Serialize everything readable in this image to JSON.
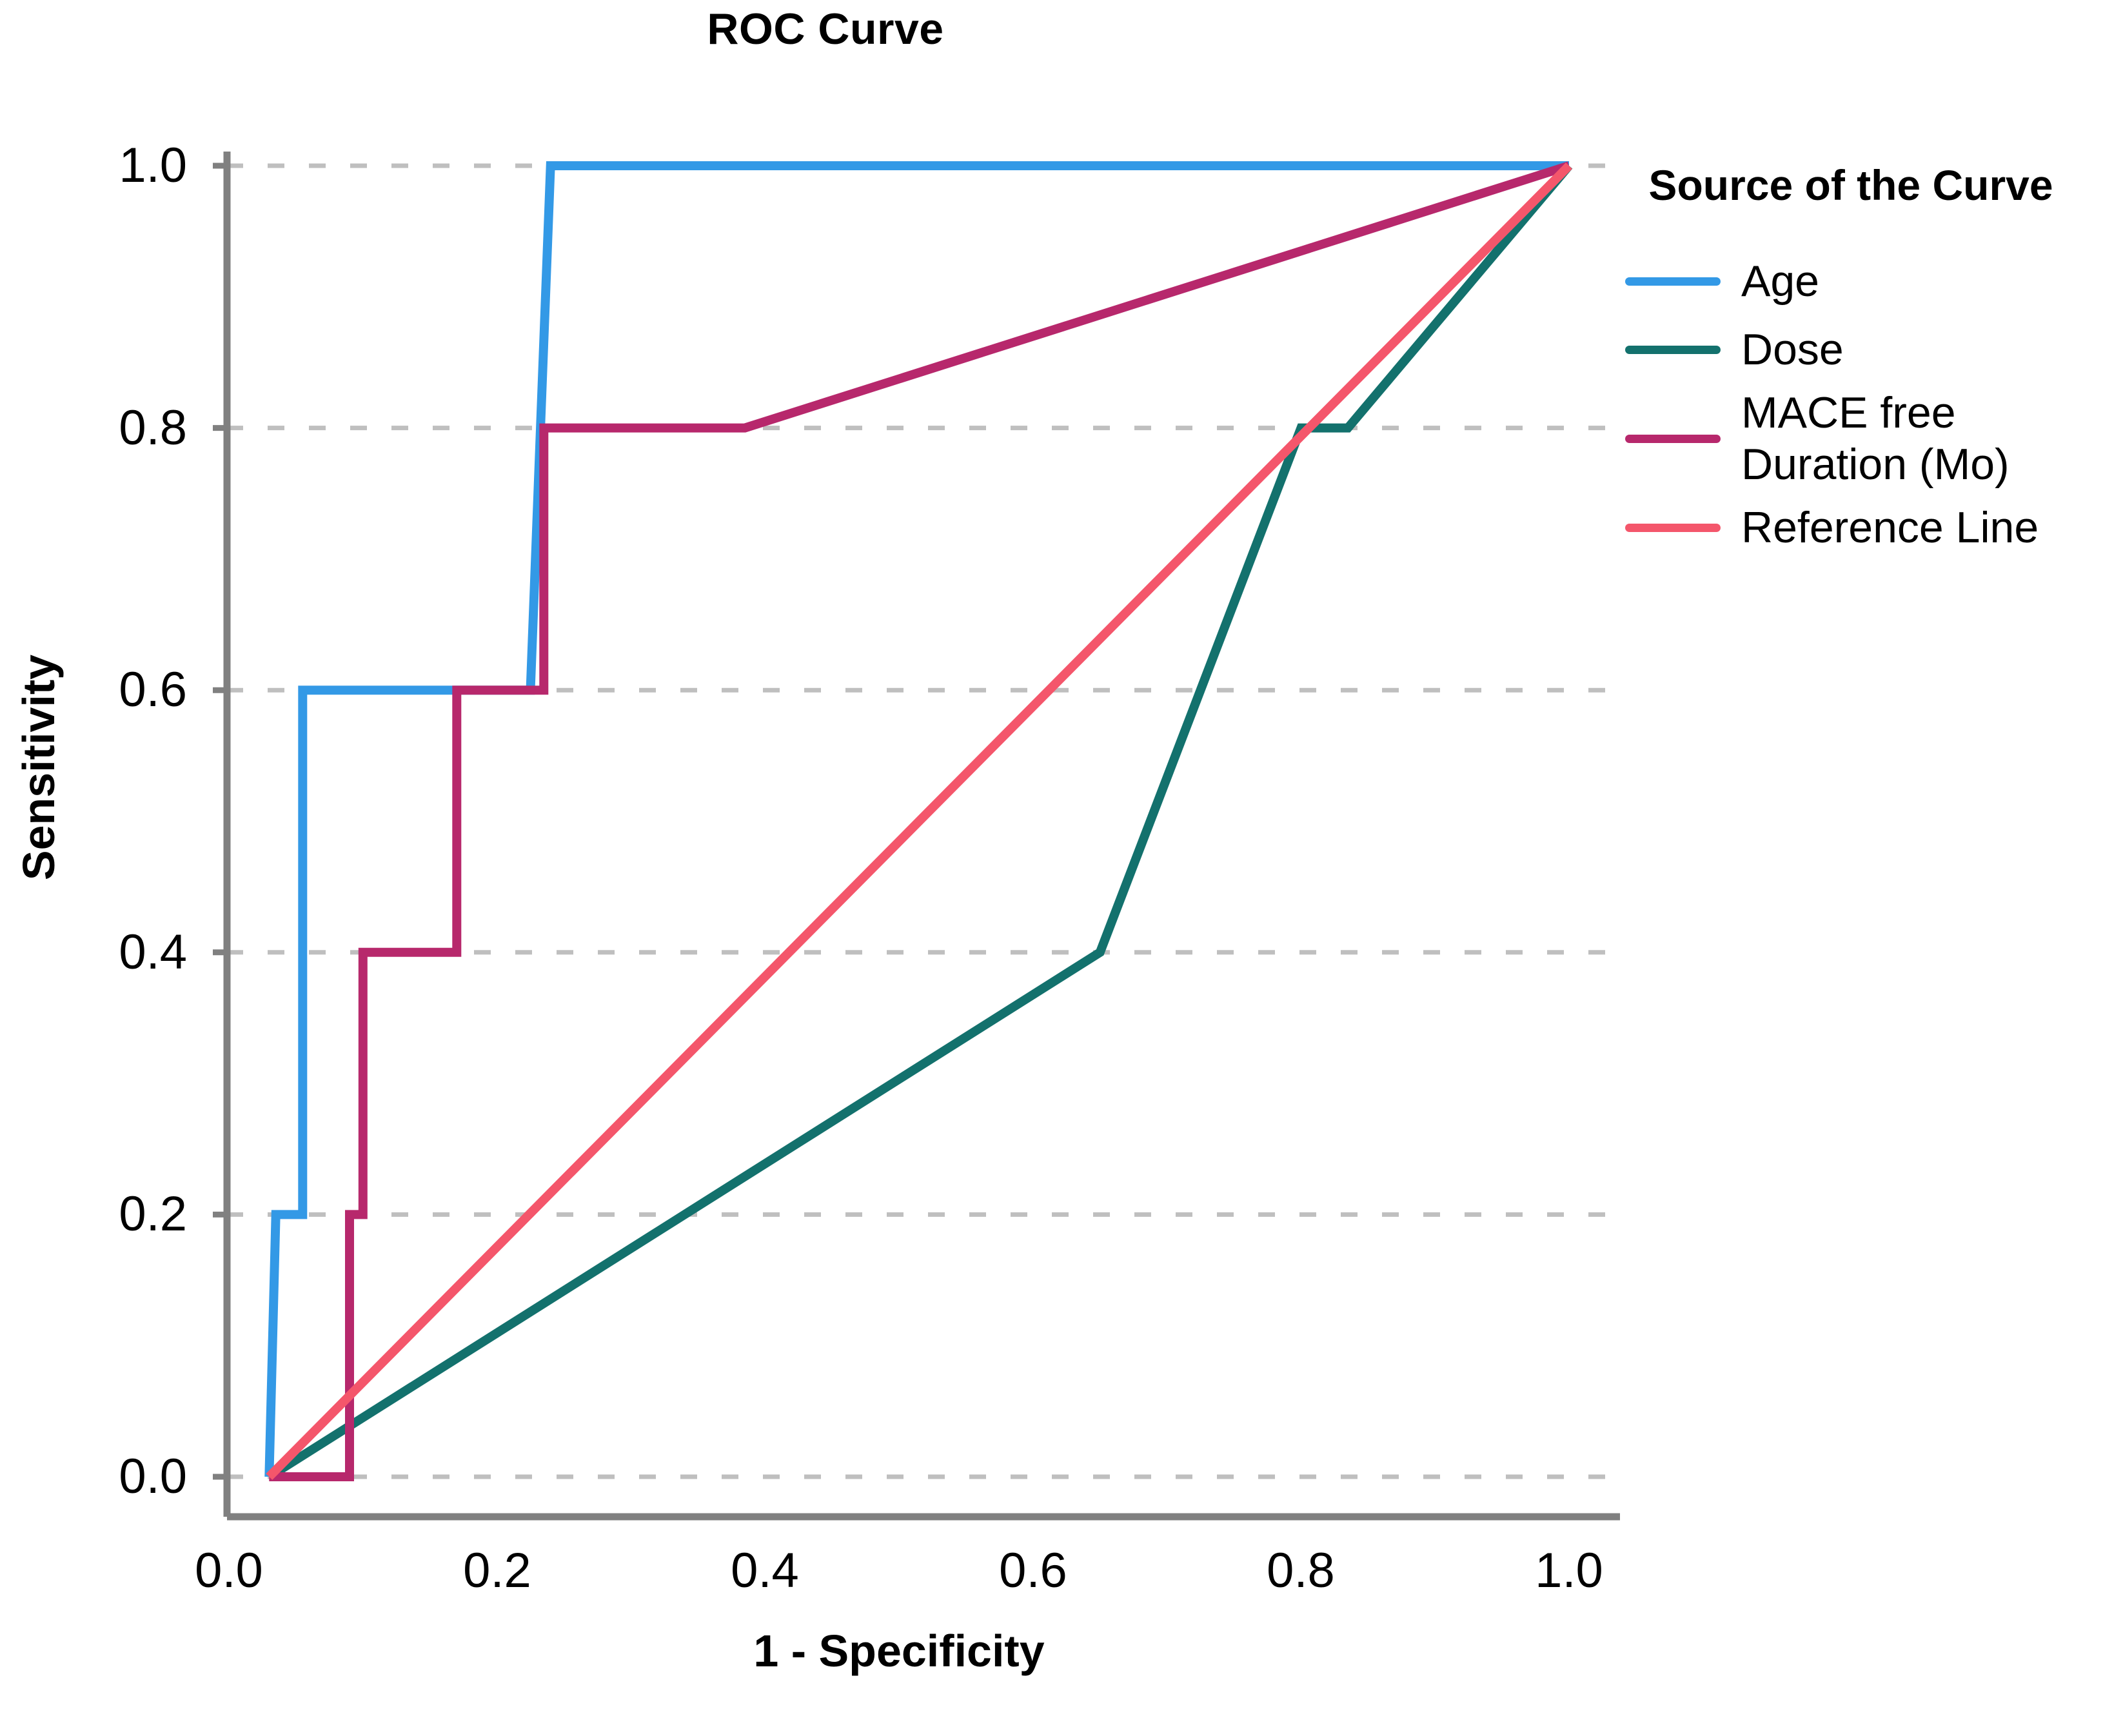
{
  "chart_data": {
    "type": "line",
    "title": "ROC Curve",
    "xlabel": "1 - Specificity",
    "ylabel": "Sensitivity",
    "xlim": [
      0.0,
      1.0
    ],
    "ylim": [
      0.0,
      1.0
    ],
    "xticks": [
      "0.0",
      "0.2",
      "0.4",
      "0.6",
      "0.8",
      "1.0"
    ],
    "yticks": [
      "0.0",
      "0.2",
      "0.4",
      "0.6",
      "0.8",
      "1.0"
    ],
    "xtick_values": [
      0.0,
      0.2,
      0.4,
      0.6,
      0.8,
      1.0
    ],
    "ytick_values": [
      0.0,
      0.2,
      0.4,
      0.6,
      0.8,
      1.0
    ],
    "grid": "horizontal-dashed",
    "legend_position": "right",
    "legend_title": "Source of the Curve",
    "series": [
      {
        "name": "Age",
        "color": "#3399E6",
        "style": "step",
        "points": [
          [
            0.03,
            0.0
          ],
          [
            0.035,
            0.2
          ],
          [
            0.055,
            0.2
          ],
          [
            0.055,
            0.6
          ],
          [
            0.225,
            0.6
          ],
          [
            0.24,
            1.0
          ],
          [
            1.0,
            1.0
          ]
        ]
      },
      {
        "name": "Dose",
        "color": "#13716D",
        "style": "line",
        "points": [
          [
            0.03,
            0.0
          ],
          [
            0.65,
            0.4
          ],
          [
            0.8,
            0.8
          ],
          [
            0.835,
            0.8
          ],
          [
            1.0,
            1.0
          ]
        ]
      },
      {
        "name": "MACE free\nDuration (Mo)",
        "color": "#B7286C",
        "style": "step",
        "points": [
          [
            0.03,
            0.0
          ],
          [
            0.09,
            0.0
          ],
          [
            0.09,
            0.2
          ],
          [
            0.1,
            0.2
          ],
          [
            0.1,
            0.4
          ],
          [
            0.17,
            0.4
          ],
          [
            0.17,
            0.6
          ],
          [
            0.235,
            0.6
          ],
          [
            0.235,
            0.8
          ],
          [
            0.385,
            0.8
          ],
          [
            1.0,
            1.0
          ]
        ]
      },
      {
        "name": "Reference Line",
        "color": "#F4566B",
        "style": "line",
        "points": [
          [
            0.03,
            0.0
          ],
          [
            1.0,
            1.0
          ]
        ]
      }
    ]
  },
  "legend": {
    "title": "Source of the Curve",
    "items": [
      {
        "label": "Age",
        "color": "#3399E6"
      },
      {
        "label": "Dose",
        "color": "#13716D"
      },
      {
        "label": "MACE free\nDuration (Mo)",
        "color": "#B7286C"
      },
      {
        "label": "Reference Line",
        "color": "#F4566B"
      }
    ]
  },
  "axes": {
    "x_title": "1 - Specificity",
    "y_title": "Sensitivity",
    "x_labels": [
      "0.0",
      "0.2",
      "0.4",
      "0.6",
      "0.8",
      "1.0"
    ],
    "y_labels": [
      "0.0",
      "0.2",
      "0.4",
      "0.6",
      "0.8",
      "1.0"
    ]
  },
  "title": "ROC Curve",
  "colors": {
    "age": "#3399E6",
    "dose": "#13716D",
    "mace": "#B7286C",
    "reference": "#F4566B",
    "axis": "#808080",
    "grid": "#BFBFBF"
  }
}
